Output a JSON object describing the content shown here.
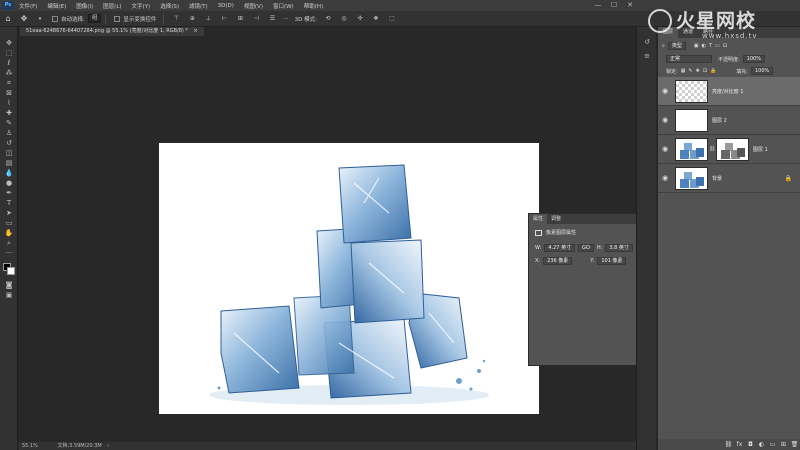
{
  "app": {
    "logo": "Ps"
  },
  "menu": [
    "文件(F)",
    "编辑(E)",
    "图像(I)",
    "图层(L)",
    "文字(Y)",
    "选择(S)",
    "滤镜(T)",
    "3D(D)",
    "视图(V)",
    "窗口(W)",
    "帮助(H)"
  ],
  "window_controls": {
    "minimize": "—",
    "maximize": "☐",
    "close": "✕"
  },
  "options": {
    "auto_select_label": "自动选择:",
    "auto_select_value": "组",
    "show_transform_label": "显示变换控件"
  },
  "document": {
    "tab_title": "51eaa-6248676-64407284.png @ 55.1% (亮度/对比度 1, RGB/8) *",
    "tab_close": "×"
  },
  "status": {
    "zoom": "55.1%",
    "doc_info": "文档:3.59M/20.3M"
  },
  "properties": {
    "tabs": [
      "属性",
      "调整"
    ],
    "section": "像素图层属性",
    "w_label": "W:",
    "w_value": "4.27 英寸",
    "link_label": "GO",
    "h_label": "H:",
    "h_value": "3.8 英寸",
    "x_label": "X:",
    "x_value": "236 像素",
    "y_label": "Y:",
    "y_value": "101 像素"
  },
  "layers_panel": {
    "tabs": [
      "图层",
      "通道",
      "路径"
    ],
    "filter_label": "类型",
    "blend_mode": "正常",
    "opacity_label": "不透明度:",
    "opacity_value": "100%",
    "lock_label": "锁定:",
    "fill_label": "填充:",
    "fill_value": "100%",
    "layers": [
      {
        "name": "亮度/对比度 1",
        "selected": true
      },
      {
        "name": "图层 2",
        "selected": false
      },
      {
        "name": "图层 1",
        "selected": false
      },
      {
        "name": "背景",
        "selected": false
      }
    ],
    "bottom_icons": [
      "link-icon",
      "fx-icon",
      "mask-icon",
      "adjustment-icon",
      "group-icon",
      "new-layer-icon",
      "trash-icon"
    ]
  },
  "watermark": {
    "brand": "火星网校",
    "url": "www.hxsd.tv"
  },
  "colors": {
    "accent": "#6fb6ff",
    "ice": "#3f78b8",
    "panel": "#535353",
    "bg": "#282828"
  }
}
